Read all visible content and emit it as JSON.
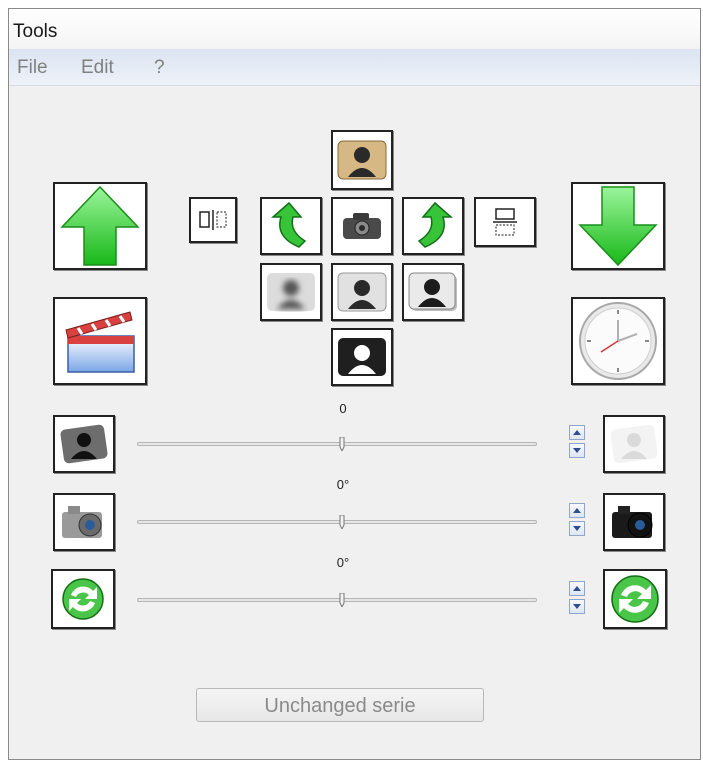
{
  "window": {
    "title": "Tools"
  },
  "menu": {
    "items": [
      "File",
      "Edit",
      "?"
    ]
  },
  "sliders": [
    {
      "label": "0",
      "value": 0
    },
    {
      "label": "0°",
      "value": 0
    },
    {
      "label": "0°",
      "value": 0
    }
  ],
  "footer": {
    "button_label": "Unchanged serie"
  },
  "colors": {
    "arrow_green": "#3cd23c",
    "window_bg": "#f0f0f0",
    "menubar": "#dbe4f1"
  },
  "icons": [
    "arrow-up-icon",
    "arrow-down-icon",
    "clapperboard-icon",
    "clock-icon",
    "portrait-sepia-icon",
    "flip-horizontal-icon",
    "rotate-left-icon",
    "camera-icon",
    "rotate-right-icon",
    "flip-vertical-icon",
    "portrait-blur-icon",
    "portrait-normal-icon",
    "portrait-sharpen-icon",
    "portrait-dark-icon",
    "brightness-dark-icon",
    "brightness-light-icon",
    "camera-small-icon",
    "camera-large-icon",
    "refresh-icon",
    "refresh-large-icon"
  ]
}
